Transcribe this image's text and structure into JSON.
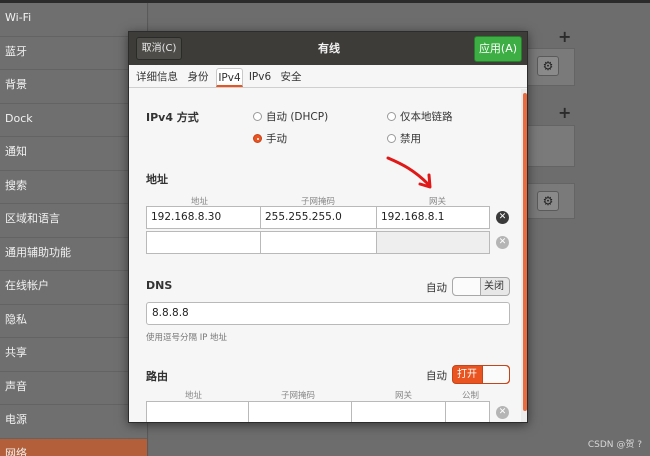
{
  "sidebar": {
    "items": [
      {
        "label": "Wi-Fi"
      },
      {
        "label": "蓝牙"
      },
      {
        "label": "背景"
      },
      {
        "label": "Dock"
      },
      {
        "label": "通知"
      },
      {
        "label": "搜索"
      },
      {
        "label": "区域和语言"
      },
      {
        "label": "通用辅助功能"
      },
      {
        "label": "在线帐户"
      },
      {
        "label": "隐私"
      },
      {
        "label": "共享"
      },
      {
        "label": "声音"
      },
      {
        "label": "电源"
      },
      {
        "label": "网络"
      }
    ],
    "active_index": 13
  },
  "dialog": {
    "cancel_label": "取消(C)",
    "title": "有线",
    "apply_label": "应用(A)",
    "tabs": [
      {
        "label": "详细信息"
      },
      {
        "label": "身份"
      },
      {
        "label": "IPv4",
        "selected": true
      },
      {
        "label": "IPv6"
      },
      {
        "label": "安全"
      }
    ],
    "ipv4_method": {
      "label": "IPv4 方式",
      "options": [
        {
          "label": "自动 (DHCP)",
          "checked": false
        },
        {
          "label": "仅本地链路",
          "checked": false
        },
        {
          "label": "手动",
          "checked": true
        },
        {
          "label": "禁用",
          "checked": false
        }
      ]
    },
    "address": {
      "label": "地址",
      "headers": [
        "地址",
        "子网掩码",
        "网关"
      ],
      "rows": [
        [
          "192.168.8.30",
          "255.255.255.0",
          "192.168.8.1"
        ],
        [
          "",
          "",
          ""
        ]
      ]
    },
    "dns": {
      "label": "DNS",
      "auto_label": "自动",
      "switch_label": "关闭",
      "switch_on": false,
      "value": "8.8.8.8",
      "hint": "使用逗号分隔 IP 地址"
    },
    "routes": {
      "label": "路由",
      "auto_label": "自动",
      "switch_label": "打开",
      "switch_on": true,
      "headers": [
        "地址",
        "子网掩码",
        "网关",
        "公制"
      ]
    }
  },
  "watermark": "CSDN @贺 ?",
  "colors": {
    "accent": "#e95420",
    "apply": "#3cae44",
    "annotation_arrow": "#e01818"
  }
}
